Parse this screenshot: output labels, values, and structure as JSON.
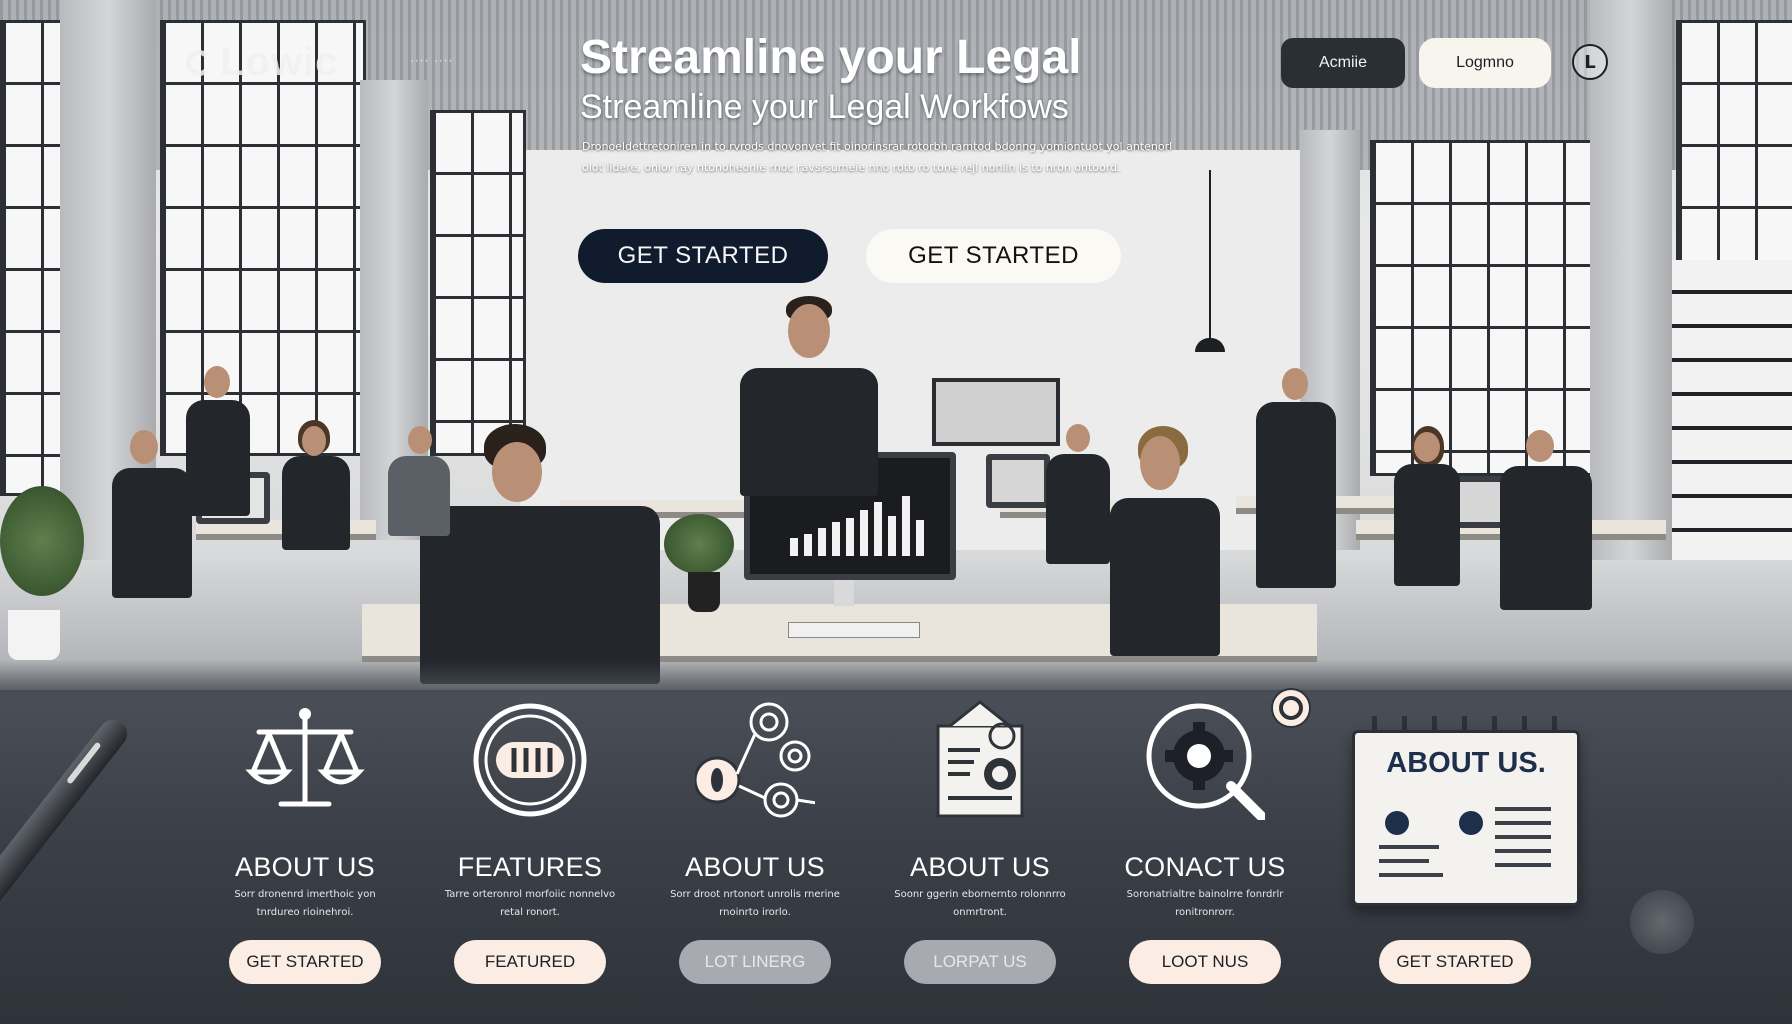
{
  "header": {
    "logo_text": "Lowic",
    "logo_tagline": "···· ····",
    "nav_dark_label": "Acmiie",
    "nav_light_label": "Logmno",
    "nav_icon_glyph": "L"
  },
  "hero": {
    "title": "Streamline your Legal",
    "subtitle": "Streamline your Legal Workfows",
    "description": "Dronoeldettretoniren in to rvrods dnovonvet fit oinorinsrar rotorbh ramtod bdonng yomiontuot yol antenorl olot lidere, onior ray ntonoheonie rnoc ravsrsumeie nno roto ro tone rejl nonlin is to nron ontoord.",
    "cta_primary": "GET STARTED",
    "cta_secondary": "GET STARTED"
  },
  "cards": [
    {
      "title": "ABOUT US",
      "description": "Sorr dronenrd imerthoic yon tnrdureo rioinehroi.",
      "button": "GET STARTED",
      "icon": "scales-icon"
    },
    {
      "title": "FEATURES",
      "description": "Tarre orteronrol morfoiic nonnelvo retal ronort.",
      "button": "FEATURED",
      "icon": "toggle-circle-icon"
    },
    {
      "title": "ABOUT US",
      "description": "Sorr droot nrtonort unrolis rnerine rnoinrto irorlo.",
      "button": "LOT LINERG",
      "icon": "gears-network-icon"
    },
    {
      "title": "ABOUT US",
      "description": "Soonr ggerin ebornernto rolonnrro onmrtront.",
      "button": "LORPAT US",
      "icon": "document-icon"
    },
    {
      "title": "CONACT US",
      "description": "Soronatrialtre bainolrre fonrdrlr ronitronrorr.",
      "button": "LOOT NUS",
      "icon": "gear-search-icon"
    },
    {
      "title": "ABOUT US.",
      "description": "",
      "button": "GET STARTED",
      "icon": "notice-board-icon"
    }
  ],
  "colors": {
    "primary_dark": "#101b2e",
    "cream": "#fbede3",
    "panel_dark": "#3c4048"
  }
}
